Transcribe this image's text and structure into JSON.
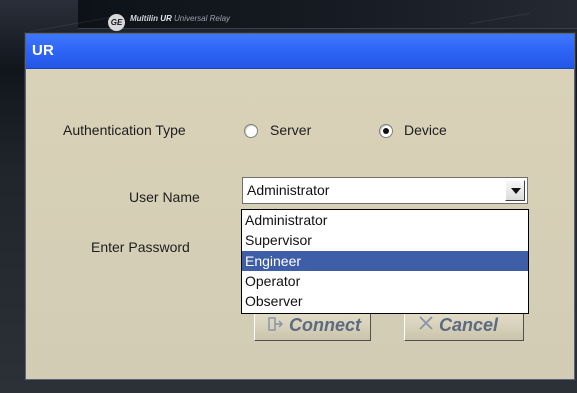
{
  "background": {
    "brand": "Multilin",
    "ur_label": "UR",
    "subtitle": "Universal Relay"
  },
  "dialog": {
    "title": "UR"
  },
  "form": {
    "authentication_label": "Authentication Type",
    "server_label": "Server",
    "device_label": "Device",
    "selected_auth": "Device",
    "user_name_label": "User Name",
    "password_label": "Enter Password",
    "selected_user": "Administrator",
    "user_options": [
      "Administrator",
      "Supervisor",
      "Engineer",
      "Operator",
      "Observer"
    ],
    "highlighted_user": "Engineer"
  },
  "buttons": {
    "connect": "Connect",
    "cancel": "Cancel"
  },
  "colors": {
    "titlebar": "#2f66f6",
    "panel": "#d7d1b8",
    "selection": "#3f5ea8",
    "button_text": "#5c6b80"
  },
  "icons": {
    "connect": "connect-icon",
    "cancel": "cancel-icon",
    "combo_arrow": "chevron-down-icon",
    "logo": "ge-logo-icon"
  }
}
